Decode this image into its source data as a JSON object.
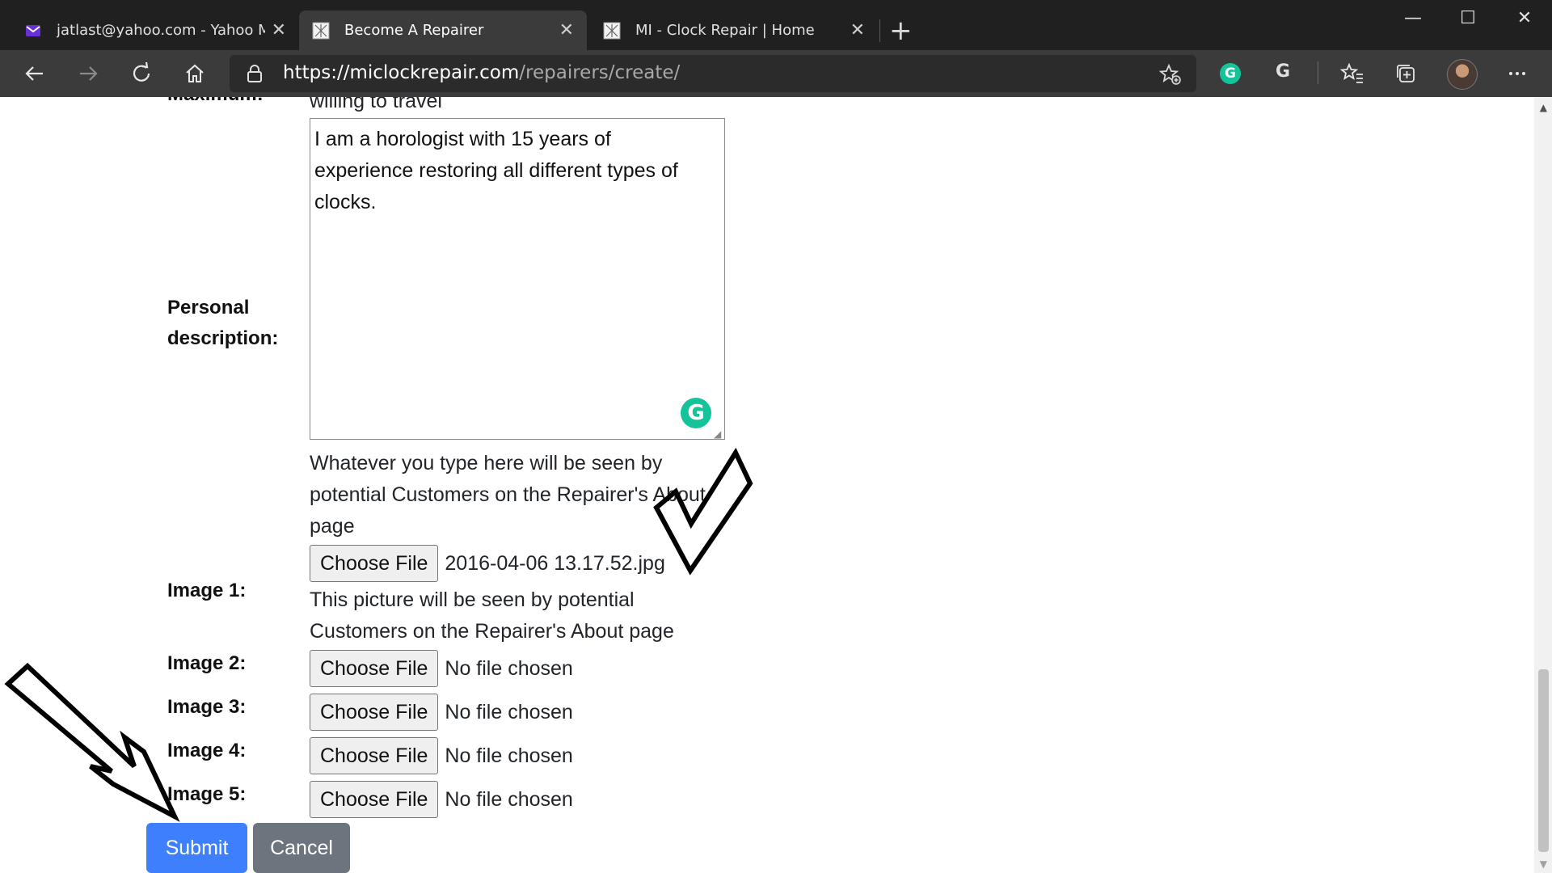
{
  "browser": {
    "tabs": [
      {
        "label": "jatlast@yahoo.com - Yahoo Mail",
        "icon": "mail-icon",
        "active": false
      },
      {
        "label": "Become A Repairer",
        "icon": "clock-site-icon",
        "active": true
      },
      {
        "label": "MI - Clock Repair | Home",
        "icon": "clock-site-icon",
        "active": false
      }
    ],
    "tab_close_glyph": "✕",
    "new_tab_glyph": "+",
    "window_controls": {
      "minimize": "—",
      "maximize": "☐",
      "close": "✕"
    },
    "address": {
      "host": "https://miclockrepair.com",
      "path": "/repairers/create/"
    },
    "extensions": {
      "grammarly_letter": "G",
      "second_letter": "G"
    },
    "colors": {
      "tabbar": "#202020",
      "toolbar": "#3b3b3b",
      "grammarly": "#15c39a"
    }
  },
  "form": {
    "cut_off_label": "Maximum:",
    "cut_off_text": "willing to travel",
    "personal_description": {
      "label_line1": "Personal",
      "label_line2": "description:",
      "value": "I am a horologist with 15 years of\nexperience restoring all different types of\nclocks.",
      "help_line1": "Whatever you type here will be seen by",
      "help_line2": "potential Customers on the Repairer's About",
      "help_line3": "page"
    },
    "choose_file_label": "Choose File",
    "images": [
      {
        "label": "Image 1:",
        "file": "2016-04-06 13.17.52.jpg",
        "help_line1": "This picture will be seen by potential",
        "help_line2": "Customers on the Repairer's About page"
      },
      {
        "label": "Image 2:",
        "file": "No file chosen"
      },
      {
        "label": "Image 3:",
        "file": "No file chosen"
      },
      {
        "label": "Image 4:",
        "file": "No file chosen"
      },
      {
        "label": "Image 5:",
        "file": "No file chosen"
      }
    ],
    "submit_label": "Submit",
    "cancel_label": "Cancel",
    "colors": {
      "submit": "#3d7ffc",
      "cancel": "#6c757d"
    }
  },
  "annotations": {
    "checkmark": "checkmark-annotation",
    "arrow": "arrow-annotation"
  }
}
